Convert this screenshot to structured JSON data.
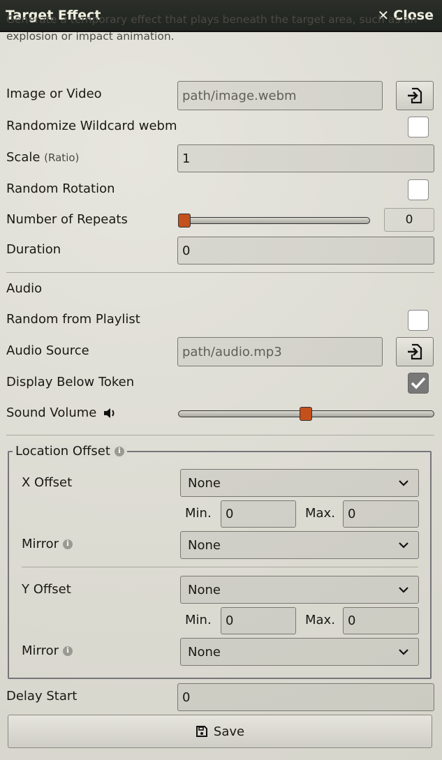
{
  "window": {
    "title": "Target Effect",
    "close_label": "Close"
  },
  "hint": "Generate a temporary effect that plays beneath the target area, such as an explosion or impact animation.",
  "image": {
    "label": "Image or Video",
    "placeholder": "path/image.webm"
  },
  "randomize": {
    "label": "Randomize Wildcard webm",
    "checked": false
  },
  "scale": {
    "label": "Scale",
    "sub": "(Ratio)",
    "value": "1"
  },
  "random_rotation": {
    "label": "Random Rotation",
    "checked": false
  },
  "repeats": {
    "label": "Number of Repeats",
    "value": "0",
    "fraction": 0.0
  },
  "duration": {
    "label": "Duration",
    "value": "0"
  },
  "audio": {
    "heading": "Audio",
    "random_playlist_label": "Random from Playlist",
    "source_label": "Audio Source",
    "source_placeholder": "path/audio.mp3",
    "below_token_label": "Display Below Token",
    "below_token_checked": true,
    "volume_label": "Sound Volume",
    "volume_fraction": 0.5
  },
  "location": {
    "legend": "Location Offset",
    "x_label": "X Offset",
    "x_value": "None",
    "x_min_label": "Min.",
    "x_min": "0",
    "x_max_label": "Max.",
    "x_max": "0",
    "x_mirror_label": "Mirror",
    "x_mirror_value": "None",
    "y_label": "Y Offset",
    "y_value": "None",
    "y_min_label": "Min.",
    "y_min": "0",
    "y_max_label": "Max.",
    "y_max": "0",
    "y_mirror_label": "Mirror",
    "y_mirror_value": "None"
  },
  "delay": {
    "label": "Delay Start",
    "value": "0"
  },
  "save_label": "Save",
  "colors": {
    "accent": "#c4501c",
    "titlebar": "#23271f"
  }
}
